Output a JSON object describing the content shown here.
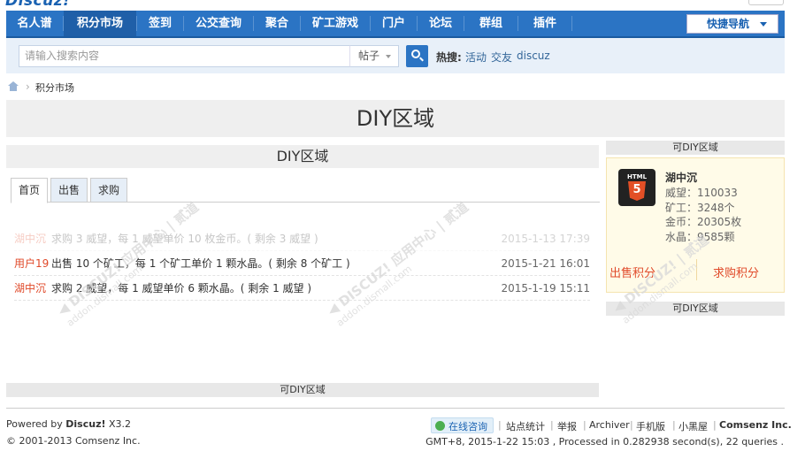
{
  "header": {
    "logo_text": "Discuz!"
  },
  "nav": {
    "items": [
      "名人谱",
      "积分市场",
      "签到",
      "公交查询",
      "聚合",
      "矿工游戏",
      "门户",
      "论坛",
      "群组",
      "插件"
    ],
    "quick_nav": "快捷导航"
  },
  "search": {
    "placeholder": "请输入搜索内容",
    "type": "帖子",
    "hot_label": "热搜:",
    "hot_links": [
      "活动",
      "交友",
      "discuz"
    ]
  },
  "breadcrumb": {
    "current": "积分市场"
  },
  "banner": {
    "title": "DIY区域"
  },
  "main": {
    "title": "DIY区域",
    "tabs": [
      "首页",
      "出售",
      "求购"
    ],
    "rows": [
      {
        "user": "湖中沉",
        "message": "求购  3 威望，每 1 威望单价 10 枚金币。( 剩余 3 威望 )",
        "time": "2015-1-13 17:39"
      },
      {
        "user": "用户19",
        "message": "出售  10 个矿工，每 1 个矿工单价 1 颗水晶。( 剩余 8 个矿工 )",
        "time": "2015-1-21 16:01"
      },
      {
        "user": "湖中沉",
        "message": "求购  2 威望，每 1 威望单价 6 颗水晶。( 剩余 1 威望 )",
        "time": "2015-1-19 15:11"
      }
    ],
    "footer_label": "可DIY区域"
  },
  "sidebar": {
    "header_label": "可DIY区域",
    "user": {
      "name": "湖中沉",
      "stats": [
        "威望：110033",
        "矿工：3248个",
        "金币：20305枚",
        "水晶：9585颗"
      ]
    },
    "sell_button": "出售积分",
    "buy_button": "求购积分",
    "footer_label": "可DIY区域"
  },
  "footer": {
    "powered_prefix": "Powered by ",
    "powered_brand": "Discuz!",
    "powered_version": " X3.2",
    "copyright": "© 2001-2013 Comsenz Inc.",
    "online_button": "在线咨询",
    "links": [
      "站点统计",
      "举报",
      "Archiver",
      "手机版",
      "小黑屋"
    ],
    "company": "Comsenz Inc.",
    "stats": "GMT+8, 2015-1-22 15:03 , Processed in 0.282938 second(s), 22 queries ."
  },
  "colors": {
    "nav_bg": "#2b74c4",
    "accent_red": "#e04a2a",
    "link_blue": "#336699"
  }
}
